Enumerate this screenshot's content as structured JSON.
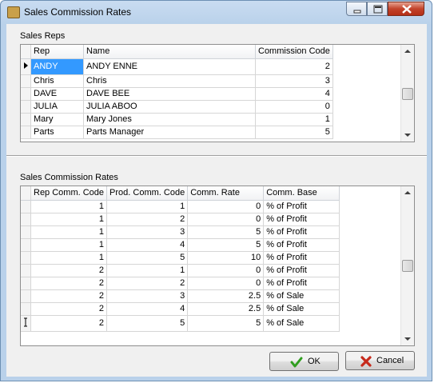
{
  "window": {
    "title": "Sales Commission Rates"
  },
  "sales_reps": {
    "label": "Sales Reps",
    "columns": [
      "Rep",
      "Name",
      "Commission Code"
    ],
    "rows": [
      {
        "rep": "ANDY",
        "name": "ANDY ENNE",
        "code": "2"
      },
      {
        "rep": "Chris",
        "name": "Chris",
        "code": "3"
      },
      {
        "rep": "DAVE",
        "name": "DAVE BEE",
        "code": "4"
      },
      {
        "rep": "JULIA",
        "name": "JULIA ABOO",
        "code": "0"
      },
      {
        "rep": "Mary",
        "name": "Mary Jones",
        "code": "1"
      },
      {
        "rep": "Parts",
        "name": "Parts Manager",
        "code": "5"
      }
    ]
  },
  "commission_rates": {
    "label": "Sales Commission Rates",
    "columns": [
      "Rep Comm. Code",
      "Prod. Comm. Code",
      "Comm. Rate",
      "Comm. Base"
    ],
    "rows": [
      {
        "rep_code": "1",
        "prod_code": "1",
        "rate": "0",
        "base": "% of Profit"
      },
      {
        "rep_code": "1",
        "prod_code": "2",
        "rate": "0",
        "base": "% of Profit"
      },
      {
        "rep_code": "1",
        "prod_code": "3",
        "rate": "5",
        "base": "% of Profit"
      },
      {
        "rep_code": "1",
        "prod_code": "4",
        "rate": "5",
        "base": "% of Profit"
      },
      {
        "rep_code": "1",
        "prod_code": "5",
        "rate": "10",
        "base": "% of Profit"
      },
      {
        "rep_code": "2",
        "prod_code": "1",
        "rate": "0",
        "base": "% of Profit"
      },
      {
        "rep_code": "2",
        "prod_code": "2",
        "rate": "0",
        "base": "% of Profit"
      },
      {
        "rep_code": "2",
        "prod_code": "3",
        "rate": "2.5",
        "base": "% of Sale"
      },
      {
        "rep_code": "2",
        "prod_code": "4",
        "rate": "2.5",
        "base": "% of Sale"
      },
      {
        "rep_code": "2",
        "prod_code": "5",
        "rate": "5",
        "base": "% of Sale"
      }
    ]
  },
  "buttons": {
    "ok": "OK",
    "cancel": "Cancel"
  },
  "colors": {
    "selection": "#3399ff",
    "ok_check": "#2f9e1f",
    "cancel_x": "#c62a1c"
  },
  "icons": {
    "ok": "checkmark-icon",
    "cancel": "x-icon",
    "app": "app-icon"
  }
}
